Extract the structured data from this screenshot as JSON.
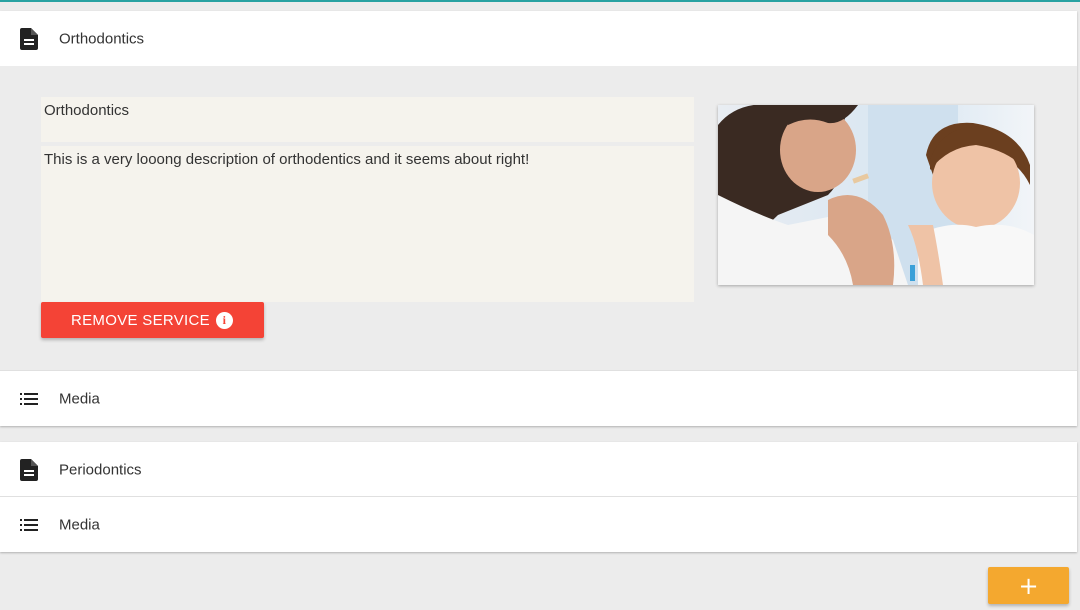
{
  "services": [
    {
      "header_label": "Orthodontics",
      "header_icon": "document-icon",
      "title_value": "Orthodontics",
      "description_value": "This is a very looong description of orthodentics and it seems about right!",
      "remove_label": "REMOVE SERVICE",
      "media_label": "Media",
      "media_icon": "list-icon"
    },
    {
      "header_label": "Periodontics",
      "header_icon": "document-icon",
      "media_label": "Media",
      "media_icon": "list-icon"
    }
  ],
  "fab": {
    "label": "+"
  },
  "colors": {
    "accent_top": "#2aa3a3",
    "remove_button": "#f44336",
    "fab": "#f4a82f",
    "field_bg": "#f5f3ed"
  }
}
